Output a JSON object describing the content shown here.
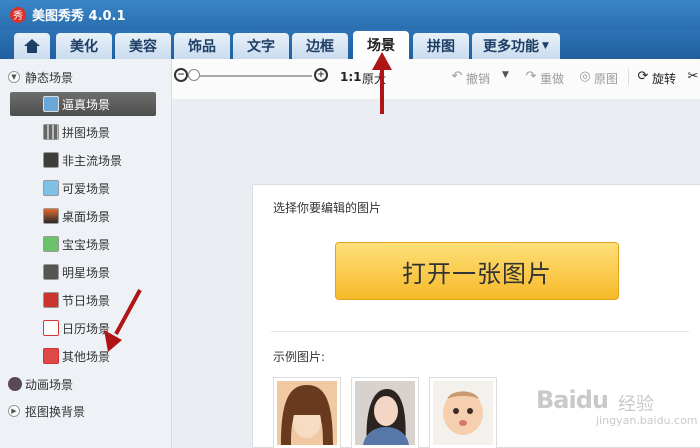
{
  "app": {
    "title": "美图秀秀 4.0.1",
    "logo_text": "秀"
  },
  "tabs": [
    {
      "label": "",
      "icon": "home-icon"
    },
    {
      "label": "美化"
    },
    {
      "label": "美容"
    },
    {
      "label": "饰品"
    },
    {
      "label": "文字"
    },
    {
      "label": "边框"
    },
    {
      "label": "场景",
      "active": true
    },
    {
      "label": "拼图"
    },
    {
      "label": "更多功能",
      "has_dropdown": true
    }
  ],
  "sidebar": {
    "static_group": "静态场景",
    "items": [
      {
        "label": "逼真场景",
        "selected": true
      },
      {
        "label": "拼图场景"
      },
      {
        "label": "非主流场景"
      },
      {
        "label": "可爱场景"
      },
      {
        "label": "桌面场景"
      },
      {
        "label": "宝宝场景"
      },
      {
        "label": "明星场景"
      },
      {
        "label": "节日场景"
      },
      {
        "label": "日历场景"
      },
      {
        "label": "其他场景"
      }
    ],
    "animated_group": "动画场景",
    "cutout_group": "抠图换背景"
  },
  "toolbar": {
    "ratio_label": "1:1",
    "original_size": "原大",
    "undo": "撤销",
    "redo": "重做",
    "original_image": "原图",
    "rotate": "旋转"
  },
  "main": {
    "prompt": "选择你要编辑的图片",
    "open_button": "打开一张图片",
    "samples_label": "示例图片:"
  },
  "watermark": {
    "brand": "Bai",
    "paw": "du",
    "zh": "经验",
    "sub": "jingyan.baidu.com"
  },
  "colors": {
    "title_bar": "#2a6fb0",
    "tab_active": "#ffffff",
    "open_button": "#f6b928",
    "selected_item": "#5a5a5a",
    "annotation_arrow": "#b01515"
  }
}
